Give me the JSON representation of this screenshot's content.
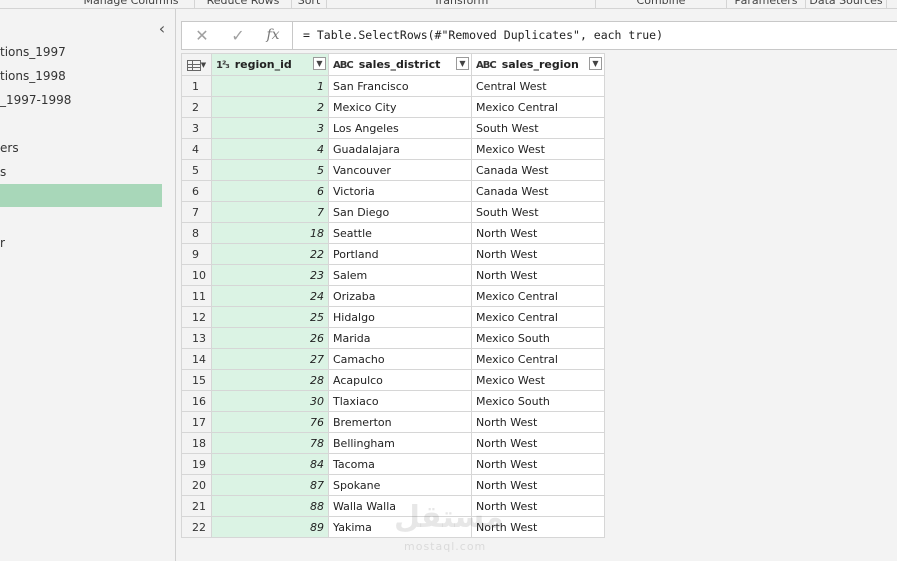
{
  "ribbon": {
    "groups": [
      "Manage Columns",
      "Reduce Rows",
      "Sort",
      "Transform",
      "Combine",
      "Parameters",
      "Data Sources"
    ]
  },
  "queries": [
    {
      "label": "tions_1997"
    },
    {
      "label": "tions_1998"
    },
    {
      "label": "_1997-1998"
    },
    {
      "label": ""
    },
    {
      "label": "ers"
    },
    {
      "label": "s"
    },
    {
      "label": ""
    },
    {
      "label": ""
    },
    {
      "label": "r"
    }
  ],
  "formula_bar": {
    "cancel_icon": "✕",
    "confirm_icon": "✓",
    "fx_label": "fx",
    "formula": "= Table.SelectRows(#\"Removed Duplicates\", each true)"
  },
  "grid": {
    "columns": [
      {
        "name": "region_id",
        "type": "1²₃"
      },
      {
        "name": "sales_district",
        "type": "ABC"
      },
      {
        "name": "sales_region",
        "type": "ABC"
      }
    ],
    "rows": [
      {
        "n": "1",
        "id": "1",
        "district": "San Francisco",
        "region": "Central West"
      },
      {
        "n": "2",
        "id": "2",
        "district": "Mexico City",
        "region": "Mexico Central"
      },
      {
        "n": "3",
        "id": "3",
        "district": "Los Angeles",
        "region": "South West"
      },
      {
        "n": "4",
        "id": "4",
        "district": "Guadalajara",
        "region": "Mexico West"
      },
      {
        "n": "5",
        "id": "5",
        "district": "Vancouver",
        "region": "Canada West"
      },
      {
        "n": "6",
        "id": "6",
        "district": "Victoria",
        "region": "Canada West"
      },
      {
        "n": "7",
        "id": "7",
        "district": "San Diego",
        "region": "South West"
      },
      {
        "n": "8",
        "id": "18",
        "district": "Seattle",
        "region": "North West"
      },
      {
        "n": "9",
        "id": "22",
        "district": "Portland",
        "region": "North West"
      },
      {
        "n": "10",
        "id": "23",
        "district": "Salem",
        "region": "North West"
      },
      {
        "n": "11",
        "id": "24",
        "district": "Orizaba",
        "region": "Mexico Central"
      },
      {
        "n": "12",
        "id": "25",
        "district": "Hidalgo",
        "region": "Mexico Central"
      },
      {
        "n": "13",
        "id": "26",
        "district": "Marida",
        "region": "Mexico South"
      },
      {
        "n": "14",
        "id": "27",
        "district": "Camacho",
        "region": "Mexico Central"
      },
      {
        "n": "15",
        "id": "28",
        "district": "Acapulco",
        "region": "Mexico West"
      },
      {
        "n": "16",
        "id": "30",
        "district": "Tlaxiaco",
        "region": "Mexico South"
      },
      {
        "n": "17",
        "id": "76",
        "district": "Bremerton",
        "region": "North West"
      },
      {
        "n": "18",
        "id": "78",
        "district": "Bellingham",
        "region": "North West"
      },
      {
        "n": "19",
        "id": "84",
        "district": "Tacoma",
        "region": "North West"
      },
      {
        "n": "20",
        "id": "87",
        "district": "Spokane",
        "region": "North West"
      },
      {
        "n": "21",
        "id": "88",
        "district": "Walla Walla",
        "region": "North West"
      },
      {
        "n": "22",
        "id": "89",
        "district": "Yakima",
        "region": "North West"
      }
    ]
  },
  "watermark": {
    "text": "مستقل",
    "sub": "mostaql.com"
  }
}
